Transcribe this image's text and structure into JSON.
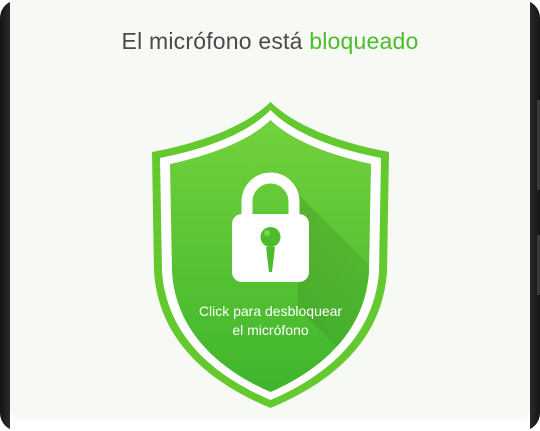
{
  "header": {
    "title_prefix": "El micrófono está",
    "title_accent": "bloqueado"
  },
  "shield": {
    "line1": "Click para desbloquear",
    "line2": "el micrófono",
    "icons": [
      "shield-icon",
      "padlock-icon",
      "microphone-icon"
    ]
  },
  "colors": {
    "accent": "#4cbb2c",
    "shield_light": "#6bd13a",
    "shield_dark": "#3cb32a",
    "title_text": "#4a4a4a",
    "background": "#f7f9f5"
  }
}
